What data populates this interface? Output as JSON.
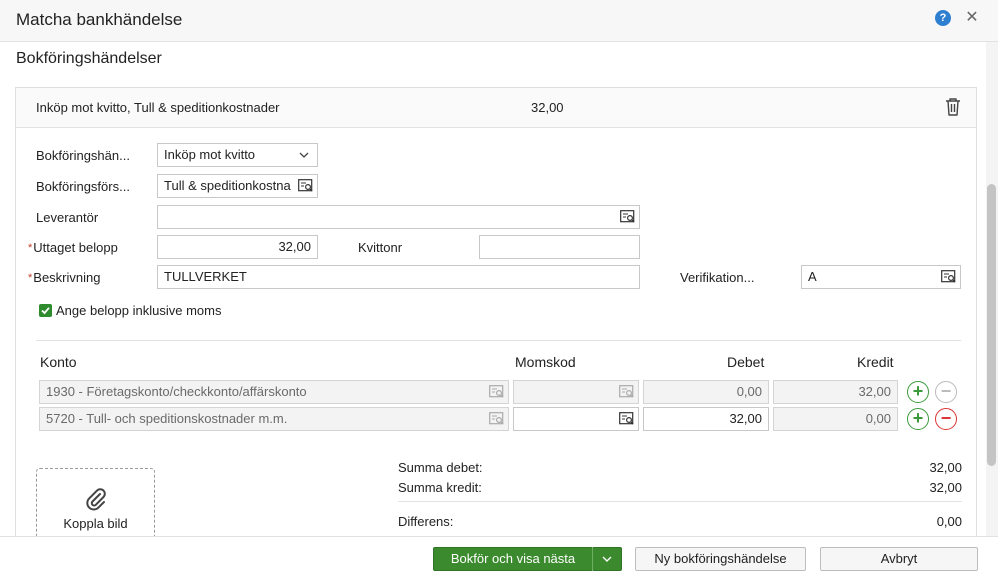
{
  "dialog": {
    "title": "Matcha bankhändelse",
    "help_glyph": "?",
    "close_glyph": "✕"
  },
  "section": {
    "title": "Bokföringshändelser"
  },
  "event": {
    "description": "Inköp mot kvitto, Tull & speditionkostnader",
    "amount": "32,00"
  },
  "form": {
    "event_type_label": "Bokföringshän...",
    "event_type_value": "Inköp mot kvitto",
    "template_label": "Bokföringsförs...",
    "template_value": "Tull & speditionkostnader",
    "supplier_label": "Leverantör",
    "supplier_value": "",
    "amount_label": "Uttaget belopp",
    "amount_value": "32,00",
    "receipt_label": "Kvittonr",
    "receipt_value": "",
    "description_label": "Beskrivning",
    "description_value": "TULLVERKET",
    "verification_label": "Verifikation...",
    "verification_value": "A",
    "required_mark": "*",
    "vat_checkbox_label": "Ange belopp inklusive moms",
    "vat_checkbox_checked": true
  },
  "table": {
    "headers": {
      "account": "Konto",
      "vat_code": "Momskod",
      "debit": "Debet",
      "credit": "Kredit"
    },
    "rows": [
      {
        "account": "1930 - Företagskonto/checkkonto/affärskonto",
        "vat_code": "",
        "debit": "0,00",
        "credit": "32,00",
        "locked": true
      },
      {
        "account": "5720 - Tull- och speditionskostnader m.m.",
        "vat_code": "",
        "debit": "32,00",
        "credit": "0,00",
        "locked": false
      }
    ],
    "add_glyph": "+",
    "remove_glyph": "−"
  },
  "attach": {
    "label": "Koppla bild"
  },
  "summary": {
    "debit_label": "Summa debet:",
    "debit_value": "32,00",
    "credit_label": "Summa kredit:",
    "credit_value": "32,00",
    "diff_label": "Differens:",
    "diff_value": "0,00"
  },
  "footer": {
    "primary_label": "Bokför och visa nästa",
    "new_label": "Ny bokföringshändelse",
    "cancel_label": "Avbryt"
  },
  "colors": {
    "accent": "#3b8a2d",
    "danger": "#dd3333",
    "help": "#2f7fd1"
  }
}
